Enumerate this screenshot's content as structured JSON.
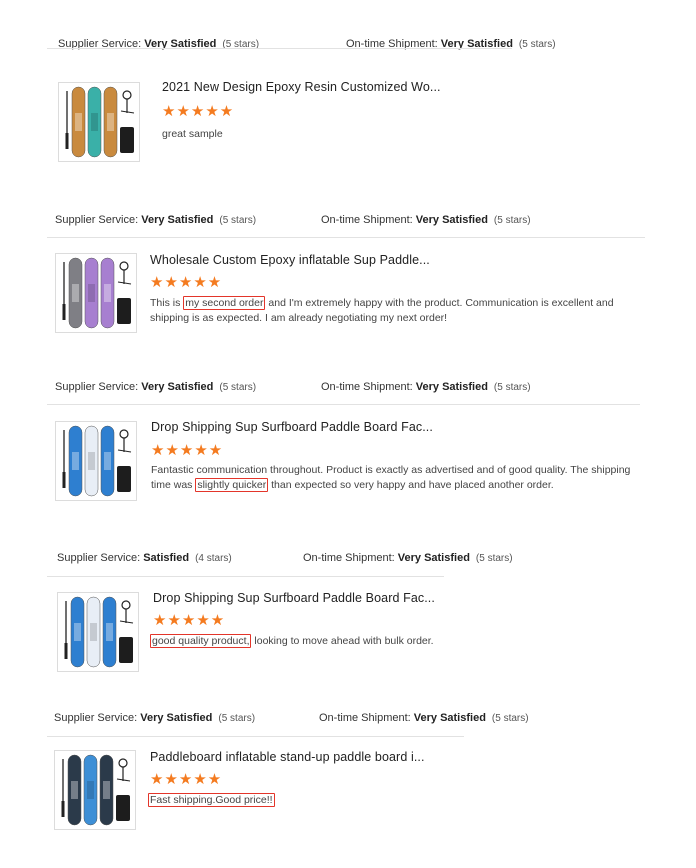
{
  "reviews": [
    {
      "supplier_label": "Supplier Service:",
      "supplier_value": "Very Satisfied",
      "supplier_stars": "(5 stars)",
      "shipment_label": "On-time Shipment:",
      "shipment_value": "Very Satisfied",
      "shipment_stars": "(5 stars)",
      "product_title": "2021 New Design Epoxy Resin Customized Wo...",
      "rating_stars": "★★★★★",
      "text_pre": "great sample",
      "text_hl": "",
      "text_post": "",
      "colors": {
        "board1": "#c98a3e",
        "board2": "#3ab0a8",
        "board3": "#c98a3e"
      }
    },
    {
      "supplier_label": "Supplier Service:",
      "supplier_value": "Very Satisfied",
      "supplier_stars": "(5 stars)",
      "shipment_label": "On-time Shipment:",
      "shipment_value": "Very Satisfied",
      "shipment_stars": "(5 stars)",
      "product_title": "Wholesale Custom Epoxy inflatable Sup Paddle...",
      "rating_stars": "★★★★★",
      "text_pre": "This is ",
      "text_hl": "my second order",
      "text_post": " and I'm extremely happy with the product. Communication is excellent and shipping is as expected. I am already negotiating my next order!",
      "colors": {
        "board1": "#7f7f85",
        "board2": "#a77fd0",
        "board3": "#a77fd0"
      }
    },
    {
      "supplier_label": "Supplier Service:",
      "supplier_value": "Very Satisfied",
      "supplier_stars": "(5 stars)",
      "shipment_label": "On-time Shipment:",
      "shipment_value": "Very Satisfied",
      "shipment_stars": "(5 stars)",
      "product_title": "Drop Shipping Sup Surfboard Paddle Board Fac...",
      "rating_stars": "★★★★★",
      "text_pre": "Fantastic communication throughout. Product is exactly as advertised and of good quality. The shipping time was ",
      "text_hl": "slightly quicker",
      "text_post": " than expected so very happy and have placed another order.",
      "colors": {
        "board1": "#2e7fd0",
        "board2": "#e8eef6",
        "board3": "#2e7fd0"
      }
    },
    {
      "supplier_label": "Supplier Service:",
      "supplier_value": "Satisfied",
      "supplier_stars": "(4 stars)",
      "shipment_label": "On-time Shipment:",
      "shipment_value": "Very Satisfied",
      "shipment_stars": "(5 stars)",
      "product_title": "Drop Shipping Sup Surfboard Paddle Board Fac...",
      "rating_stars": "★★★★★",
      "text_pre": "",
      "text_hl": "good quality product,",
      "text_post": " looking to move ahead with bulk order.",
      "colors": {
        "board1": "#2e7fd0",
        "board2": "#e8eef6",
        "board3": "#2e7fd0"
      }
    },
    {
      "supplier_label": "Supplier Service:",
      "supplier_value": "Very Satisfied",
      "supplier_stars": "(5 stars)",
      "shipment_label": "On-time Shipment:",
      "shipment_value": "Very Satisfied",
      "shipment_stars": "(5 stars)",
      "product_title": "Paddleboard inflatable stand-up paddle board i...",
      "rating_stars": "★★★★★",
      "text_pre": "",
      "text_hl": "Fast shipping.Good price!!",
      "text_post": "",
      "colors": {
        "board1": "#2b3a4a",
        "board2": "#3d8fd6",
        "board3": "#2b3a4a"
      }
    }
  ]
}
